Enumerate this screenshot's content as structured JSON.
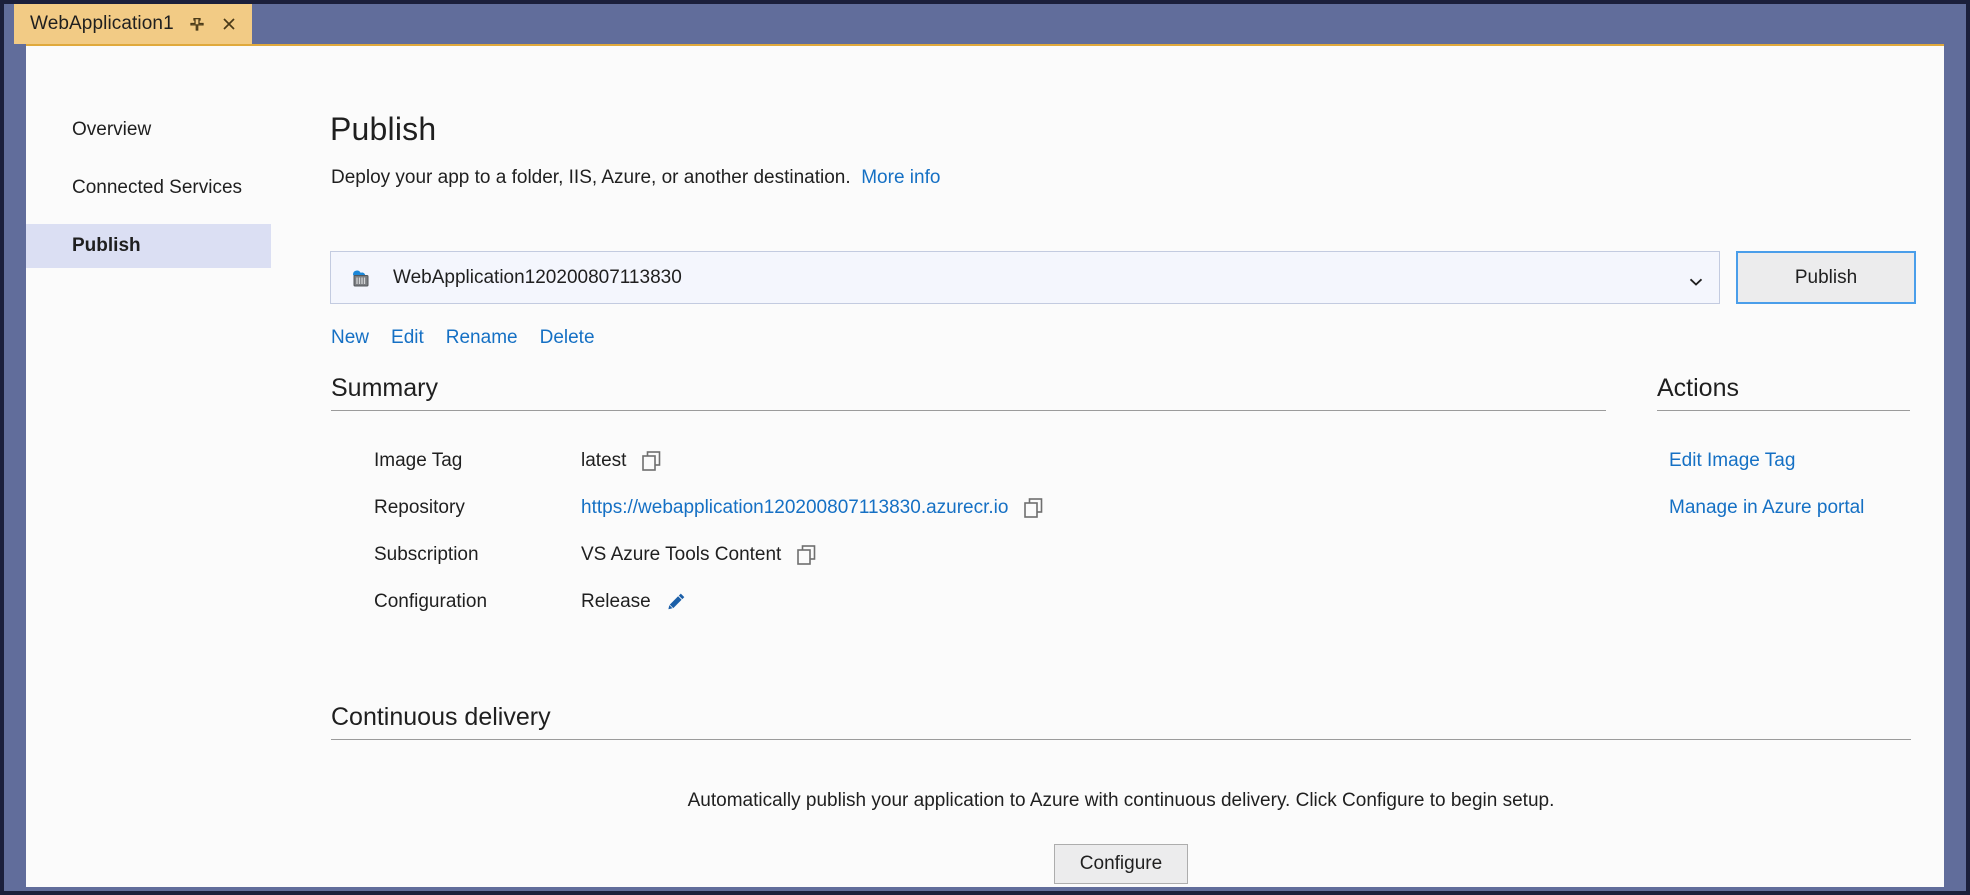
{
  "window": {
    "tab": {
      "title": "WebApplication1",
      "pin_icon": "pin-icon",
      "close_icon": "close-icon"
    }
  },
  "sidebar": {
    "items": [
      {
        "label": "Overview",
        "selected": false
      },
      {
        "label": "Connected Services",
        "selected": false
      },
      {
        "label": "Publish",
        "selected": true
      }
    ]
  },
  "main": {
    "title": "Publish",
    "subtitle": "Deploy your app to a folder, IIS, Azure, or another destination.",
    "more_info_label": "More info",
    "profile": {
      "icon": "container-registry-icon",
      "selected": "WebApplication120200807113830",
      "dropdown_icon": "chevron-down-icon",
      "publish_button": "Publish"
    },
    "profile_links": [
      "New",
      "Edit",
      "Rename",
      "Delete"
    ],
    "summary": {
      "title": "Summary",
      "rows": [
        {
          "label": "Image Tag",
          "value": "latest",
          "icon": "copy-icon",
          "is_link": false
        },
        {
          "label": "Repository",
          "value": "https://webapplication120200807113830.azurecr.io",
          "icon": "copy-icon",
          "is_link": true
        },
        {
          "label": "Subscription",
          "value": "VS Azure Tools Content",
          "icon": "copy-icon",
          "is_link": false
        },
        {
          "label": "Configuration",
          "value": "Release",
          "icon": "pencil-icon",
          "is_link": false
        }
      ]
    },
    "actions": {
      "title": "Actions",
      "items": [
        "Edit Image Tag",
        "Manage in Azure portal"
      ]
    },
    "continuous_delivery": {
      "title": "Continuous delivery",
      "description": "Automatically publish your application to Azure with continuous delivery. Click Configure to begin setup.",
      "configure_button": "Configure"
    }
  },
  "colors": {
    "tab_active": "#f2cb85",
    "chrome": "#616d9b",
    "link": "#1570c4",
    "selection": "#dbdff3",
    "accent_border": "#e0a93c",
    "focus_blue": "#4a9eea"
  }
}
